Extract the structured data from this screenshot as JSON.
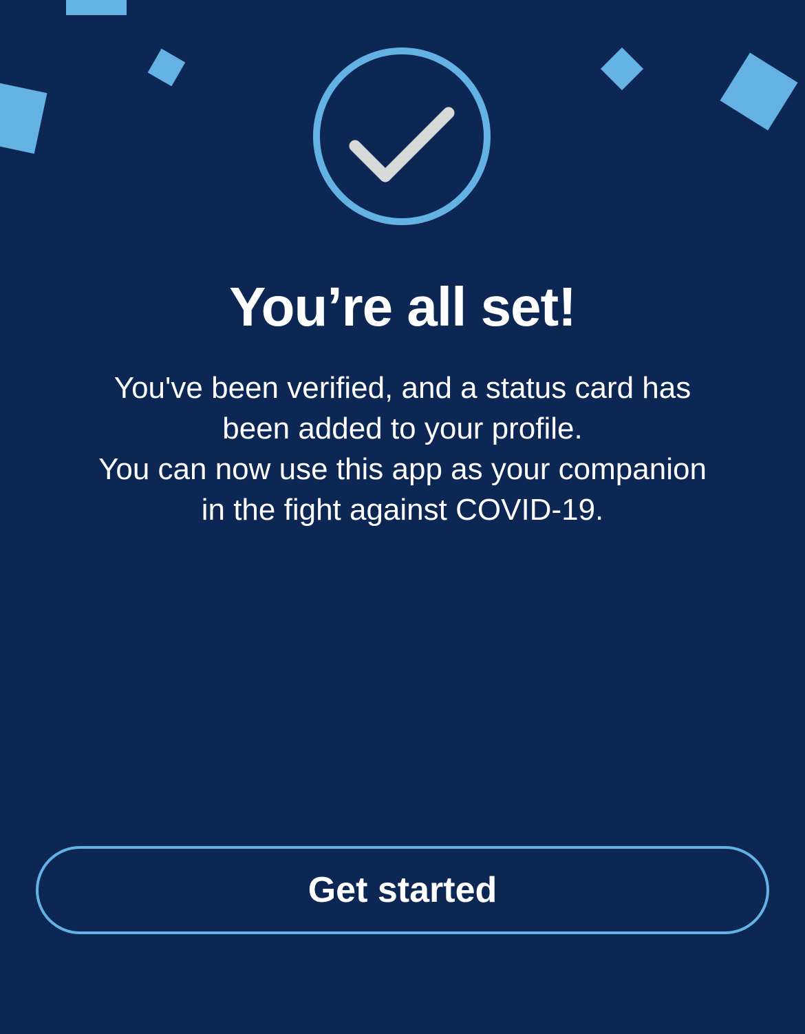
{
  "success": {
    "icon": "check-circle-icon",
    "title": "You’re all set!",
    "message_lines": [
      "You've been verified, and a status card has",
      "been added to your profile.",
      "You can now use this app as your companion",
      "in the fight against COVID-19."
    ]
  },
  "actions": {
    "get_started_label": "Get started"
  },
  "colors": {
    "background": "#0d2755",
    "accent": "#64b2e4",
    "checkmark": "#d9d9d9",
    "text": "#ffffff"
  }
}
